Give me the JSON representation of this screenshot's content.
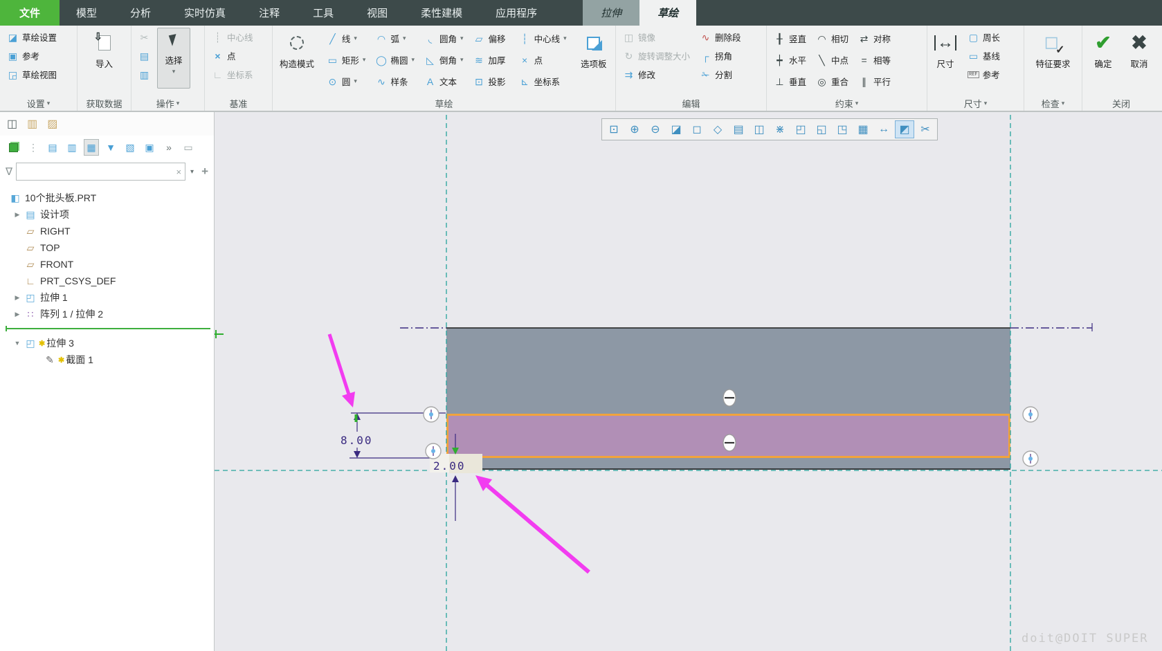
{
  "tab_bar": {
    "file_tab": "文件",
    "tabs": [
      {
        "label": "模型",
        "name": "tab-model"
      },
      {
        "label": "分析",
        "name": "tab-analysis"
      },
      {
        "label": "实时仿真",
        "name": "tab-live-simulation"
      },
      {
        "label": "注释",
        "name": "tab-annotate"
      },
      {
        "label": "工具",
        "name": "tab-tools"
      },
      {
        "label": "视图",
        "name": "tab-view"
      },
      {
        "label": "柔性建模",
        "name": "tab-flexible-modeling"
      },
      {
        "label": "应用程序",
        "name": "tab-applications"
      }
    ],
    "context_tab_extrude": "拉伸",
    "context_tab_sketch": "草绘"
  },
  "ribbon": {
    "settings": {
      "label": "设置",
      "arrow": "▾",
      "buttons": [
        {
          "label": "草绘设置",
          "glyph": "◪",
          "name": "sketch-setup-button"
        },
        {
          "label": "参考",
          "glyph": "▣",
          "name": "references-button"
        },
        {
          "label": "草绘视图",
          "glyph": "◲",
          "name": "sketch-view-button"
        }
      ]
    },
    "getdata": {
      "label": "获取数据",
      "import_label": "导入"
    },
    "operations": {
      "label": "操作",
      "arrow": "▾",
      "select_label": "选择",
      "select_arrow": "▾",
      "clipboard": [
        {
          "glyph": "✂",
          "name": "cut-icon",
          "dis": true
        },
        {
          "glyph": "▤",
          "name": "copy-icon"
        },
        {
          "glyph": "▥",
          "name": "paste-icon"
        }
      ]
    },
    "datum": {
      "label": "基准",
      "buttons": [
        {
          "label": "中心线",
          "glyph": "┊",
          "name": "datum-centerline-button",
          "dis": true
        },
        {
          "label": "点",
          "glyph": "×",
          "name": "datum-point-button",
          "dis": false
        },
        {
          "label": "坐标系",
          "glyph": "∟",
          "name": "datum-csys-button",
          "dis": true
        }
      ]
    },
    "sketch": {
      "label": "草绘",
      "construction_label": "构造模式",
      "palette_label": "选项板",
      "tools": [
        {
          "label": "线",
          "glyph": "╱",
          "arrow": "▾",
          "name": "line-button"
        },
        {
          "label": "弧",
          "glyph": "◠",
          "arrow": "▾",
          "name": "arc-button"
        },
        {
          "label": "圆角",
          "glyph": "◟",
          "arrow": "▾",
          "name": "fillet-button"
        },
        {
          "label": "偏移",
          "glyph": "▱",
          "arrow": "",
          "name": "offset-button"
        },
        {
          "label": "中心线",
          "glyph": "┆",
          "arrow": "▾",
          "name": "centerline-button"
        },
        {
          "label": "矩形",
          "glyph": "▭",
          "arrow": "▾",
          "name": "rectangle-button"
        },
        {
          "label": "椭圆",
          "glyph": "◯",
          "arrow": "▾",
          "name": "ellipse-button"
        },
        {
          "label": "倒角",
          "glyph": "◺",
          "arrow": "▾",
          "name": "chamfer-button"
        },
        {
          "label": "加厚",
          "glyph": "≋",
          "arrow": "",
          "name": "thicken-button"
        },
        {
          "label": "点",
          "glyph": "×",
          "arrow": "",
          "name": "point-button"
        },
        {
          "label": "圆",
          "glyph": "⊙",
          "arrow": "▾",
          "name": "circle-button"
        },
        {
          "label": "样条",
          "glyph": "∿",
          "arrow": "",
          "name": "spline-button"
        },
        {
          "label": "文本",
          "glyph": "A",
          "arrow": "",
          "name": "text-button"
        },
        {
          "label": "投影",
          "glyph": "⊡",
          "arrow": "",
          "name": "project-button"
        },
        {
          "label": "坐标系",
          "glyph": "⊾",
          "arrow": "",
          "name": "csys-button"
        }
      ]
    },
    "edit": {
      "label": "编辑",
      "col1": [
        {
          "label": "镜像",
          "glyph": "◫",
          "name": "mirror-button",
          "dis": true
        },
        {
          "label": "旋转调整大小",
          "glyph": "↻",
          "name": "rotate-resize-button",
          "dis": true
        },
        {
          "label": "修改",
          "glyph": "⇉",
          "name": "modify-button",
          "dis": false
        }
      ],
      "col2": [
        {
          "label": "删除段",
          "glyph": "∿",
          "name": "delete-segment-button"
        },
        {
          "label": "拐角",
          "glyph": "┌",
          "name": "corner-button"
        },
        {
          "label": "分割",
          "glyph": "✁",
          "name": "divide-button"
        }
      ]
    },
    "constrain": {
      "label": "约束",
      "arrow": "▾",
      "items": [
        {
          "label": "竖直",
          "glyph": "╂",
          "name": "vertical-constraint-button"
        },
        {
          "label": "相切",
          "glyph": "◠",
          "name": "tangent-constraint-button"
        },
        {
          "label": "对称",
          "glyph": "⇄",
          "name": "symmetric-constraint-button"
        },
        {
          "label": "水平",
          "glyph": "┿",
          "name": "horizontal-constraint-button"
        },
        {
          "label": "中点",
          "glyph": "╲",
          "name": "midpoint-constraint-button"
        },
        {
          "label": "相等",
          "glyph": "=",
          "name": "equal-constraint-button"
        },
        {
          "label": "垂直",
          "glyph": "⊥",
          "name": "perpendicular-constraint-button"
        },
        {
          "label": "重合",
          "glyph": "◎",
          "name": "coincident-constraint-button"
        },
        {
          "label": "平行",
          "glyph": "∥",
          "name": "parallel-constraint-button"
        }
      ]
    },
    "dimension": {
      "label": "尺寸",
      "arrow": "▾",
      "main_label": "尺寸",
      "main_icon": "↔",
      "small": [
        {
          "label": "周长",
          "glyph": "▢",
          "name": "perimeter-dimension-button"
        },
        {
          "label": "基线",
          "glyph": "▭",
          "name": "baseline-dimension-button"
        },
        {
          "label": "参考",
          "glyph": "REF",
          "name": "reference-dimension-button"
        }
      ]
    },
    "inspect": {
      "label": "检查",
      "arrow": "▾",
      "feature_label": "特征要求",
      "cube": "◻",
      "check": "✓"
    },
    "close": {
      "label": "关闭",
      "ok_label": "确定",
      "ok_icon": "✔",
      "cancel_label": "取消",
      "cancel_icon": "✖"
    }
  },
  "panel": {
    "tabs": [
      {
        "glyph": "◫",
        "name": "model-tree-tab",
        "color": "#5a6666"
      },
      {
        "glyph": "▥",
        "name": "layer-tree-tab",
        "color": "#c9a96a"
      },
      {
        "glyph": "▨",
        "name": "favorites-tab",
        "color": "#c9a96a"
      }
    ],
    "toolbar": [
      {
        "glyph": "⋮",
        "name": "tree-options-icon",
        "color": "#9aa4a4"
      },
      {
        "glyph": "▤",
        "name": "expand-levels-icon",
        "color": "#4aa0d5"
      },
      {
        "glyph": "▥",
        "name": "collapse-levels-icon",
        "color": "#4aa0d5"
      },
      {
        "glyph": "▦",
        "name": "tree-columns-icon",
        "color": "#4aa0d5",
        "pressed": true
      },
      {
        "glyph": "▼",
        "name": "tree-filters-icon",
        "color": "#4aa0d5"
      },
      {
        "glyph": "▧",
        "name": "tree-display-icon",
        "color": "#4aa0d5"
      },
      {
        "glyph": "▣",
        "name": "tree-list-icon",
        "color": "#4aa0d5"
      },
      {
        "glyph": "»",
        "name": "toolbar-overflow-chevron",
        "color": "#6a7474"
      },
      {
        "glyph": "▭",
        "name": "tree-settings-icon",
        "color": "#9aa4a4"
      }
    ],
    "filter": {
      "value": "",
      "placeholder": "",
      "clear": "×",
      "dropdown": "▾",
      "add": "+",
      "funnel": "∇"
    },
    "tree_top": [
      {
        "label": "10个批头板.PRT",
        "glyph": "◧",
        "color": "#58a8d8",
        "name": "tree-item-part-root",
        "indent": 12,
        "has_exp": false,
        "expander": "",
        "badge": ""
      },
      {
        "label": "设计项",
        "glyph": "▤",
        "color": "#58a8d8",
        "name": "tree-item-design-items",
        "indent": 16,
        "has_exp": true,
        "expander": "▶",
        "badge": ""
      },
      {
        "label": "RIGHT",
        "glyph": "▱",
        "color": "#b08d57",
        "name": "tree-item-right-plane",
        "indent": 16,
        "has_exp": true,
        "expander": "",
        "badge": ""
      },
      {
        "label": "TOP",
        "glyph": "▱",
        "color": "#b08d57",
        "name": "tree-item-top-plane",
        "indent": 16,
        "has_exp": true,
        "expander": "",
        "badge": ""
      },
      {
        "label": "FRONT",
        "glyph": "▱",
        "color": "#b08d57",
        "name": "tree-item-front-plane",
        "indent": 16,
        "has_exp": true,
        "expander": "",
        "badge": ""
      },
      {
        "label": "PRT_CSYS_DEF",
        "glyph": "∟",
        "color": "#b08d57",
        "name": "tree-item-csys",
        "indent": 16,
        "has_exp": true,
        "expander": "",
        "badge": ""
      },
      {
        "label": "拉伸 1",
        "glyph": "◰",
        "color": "#58a8d8",
        "name": "tree-item-extrude-1",
        "indent": 16,
        "has_exp": true,
        "expander": "▶",
        "badge": ""
      },
      {
        "label": "阵列 1 / 拉伸 2",
        "glyph": "∷",
        "color": "#8f5fb0",
        "name": "tree-item-pattern-1",
        "indent": 16,
        "has_exp": true,
        "expander": "▶",
        "badge": ""
      }
    ],
    "tree_new": [
      {
        "label": "拉伸 3",
        "glyph": "◰",
        "color": "#58a8d8",
        "name": "tree-item-extrude-3",
        "indent": 16,
        "has_exp": true,
        "expander": "▼",
        "badge": "✱"
      },
      {
        "label": "截面 1",
        "glyph": "✎",
        "color": "#666666",
        "name": "tree-item-section-1",
        "indent": 62,
        "has_exp": false,
        "expander": "",
        "badge": "✱"
      }
    ]
  },
  "float_toolbar": [
    {
      "glyph": "⊡",
      "name": "refit-icon"
    },
    {
      "glyph": "⊕",
      "name": "zoom-in-icon"
    },
    {
      "glyph": "⊖",
      "name": "zoom-out-icon"
    },
    {
      "glyph": "◪",
      "name": "repaint-icon"
    },
    {
      "glyph": "◻",
      "name": "standard-view-icon"
    },
    {
      "glyph": "◇",
      "name": "saved-orientations-icon"
    },
    {
      "glyph": "▤",
      "name": "display-style-icon"
    },
    {
      "glyph": "◫",
      "name": "view-manager-icon"
    },
    {
      "glyph": "⋇",
      "name": "datum-display-filters-icon"
    },
    {
      "glyph": "◰",
      "name": "show-annotations-icon"
    },
    {
      "glyph": "◱",
      "name": "shaded-display-icon"
    },
    {
      "glyph": "◳",
      "name": "transparent-display-icon"
    },
    {
      "glyph": "▦",
      "name": "wireframe-display-icon"
    },
    {
      "glyph": "↔",
      "name": "dimension-display-icon"
    },
    {
      "glyph": "◩",
      "name": "sketch-view-orient-icon",
      "active": true
    },
    {
      "glyph": "✂",
      "name": "section-view-icon"
    }
  ],
  "canvas": {
    "dim_height": "8.00",
    "dim_thickness": "2.00",
    "watermark": "doit@DOIT SUPER",
    "colors": {
      "solid_fill": "#8d98a5",
      "section_fill": "#b18fb6",
      "section_border": "#f2a33c",
      "reference_teal": "#27a39d",
      "dimension_purple": "#3a2a80",
      "annotation_arrow": "#f23cf0",
      "highlight_box": "#eae7da"
    }
  }
}
